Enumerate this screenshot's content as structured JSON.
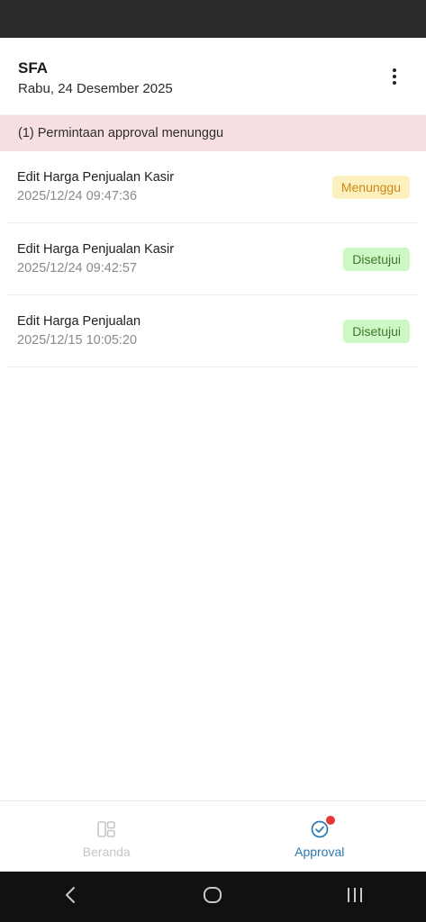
{
  "header": {
    "title": "SFA",
    "date": "Rabu, 24 Desember 2025",
    "menu_icon": "more-vertical-icon"
  },
  "banner": {
    "text": "(1) Permintaan approval menunggu"
  },
  "approvals": [
    {
      "title": "Edit Harga Penjualan Kasir",
      "time": "2025/12/24 09:47:36",
      "status": "Menunggu"
    },
    {
      "title": "Edit Harga Penjualan Kasir",
      "time": "2025/12/24 09:42:57",
      "status": "Disetujui"
    },
    {
      "title": "Edit Harga Penjualan",
      "time": "2025/12/15 10:05:20",
      "status": "Disetujui"
    }
  ],
  "bottom_nav": {
    "items": [
      {
        "label": "Beranda",
        "icon": "dashboard-icon",
        "active": false
      },
      {
        "label": "Approval",
        "icon": "check-circle-icon",
        "active": true
      }
    ]
  },
  "colors": {
    "banner_bg": "#f7dfe1",
    "pending_bg": "#fdf0bf",
    "pending_text": "#c98a17",
    "approved_bg": "#cdf7c4",
    "approved_text": "#3b7a2e",
    "accent": "#2b78b3",
    "notification": "#e53935"
  }
}
